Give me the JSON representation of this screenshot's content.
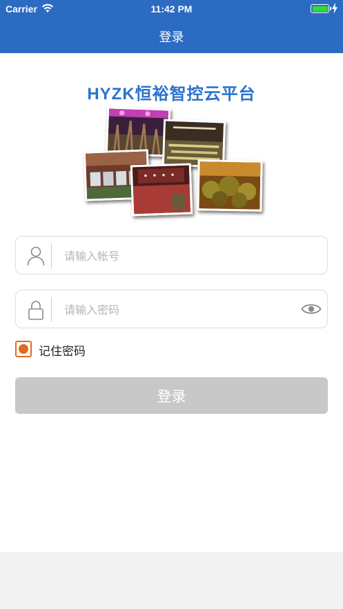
{
  "status_bar": {
    "carrier": "Carrier",
    "time": "11:42 PM",
    "battery_color": "#2ddc3a"
  },
  "nav": {
    "title": "登录",
    "background": "#2b6bc1"
  },
  "brand": {
    "title": "HYZK恒裕智控云平台",
    "color": "#2b72cf"
  },
  "form": {
    "account": {
      "icon": "user-icon",
      "placeholder": "请输入帐号",
      "value": ""
    },
    "password": {
      "icon": "lock-icon",
      "placeholder": "请输入密码",
      "value": "",
      "toggle_icon": "eye-icon"
    },
    "remember": {
      "label": "记住密码",
      "checked": true,
      "color": "#e06a1f"
    },
    "submit": {
      "label": "登录",
      "color": "#c8c8c8"
    }
  }
}
